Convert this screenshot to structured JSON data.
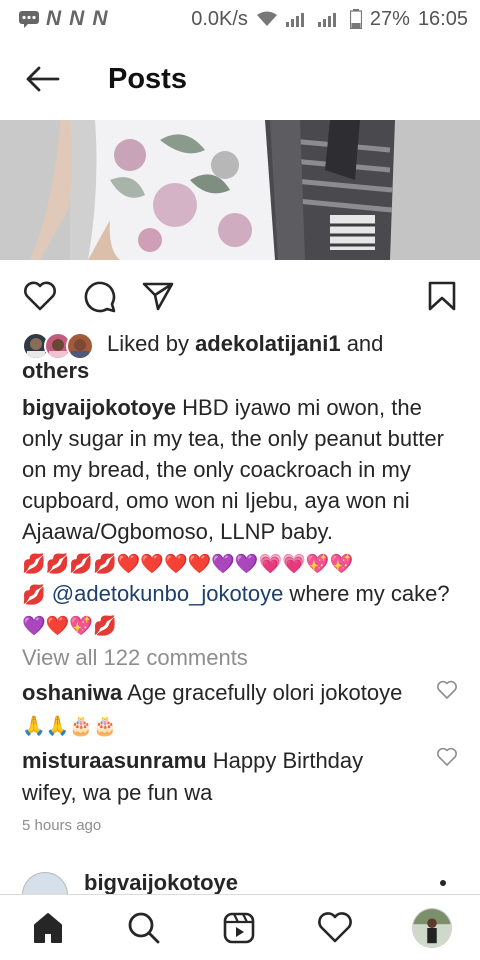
{
  "status_bar": {
    "network_labels": [
      "N",
      "N",
      "N"
    ],
    "speed": "0.0K/s",
    "battery": "27%",
    "time": "16:05"
  },
  "header": {
    "title": "Posts"
  },
  "likes": {
    "prefix": "Liked by ",
    "user": "adekolatijani1",
    "middle": " and",
    "others": "others"
  },
  "caption": {
    "username": "bigvaijokotoye",
    "text": " HBD iyawo mi owon, the only sugar in my tea, the only peanut butter on my bread, the only coackroach in my cupboard, omo won ni Ijebu, aya won ni Ajaawa/Ogbomoso, LLNP baby.",
    "emoji_line_1": "💋💋💋💋❤️❤️❤️❤️💜💜💗💗💖💖",
    "emoji_line_2_prefix": "💋",
    "mention": "@adetokunbo_jokotoye",
    "after_mention": " where my cake?",
    "emoji_line_3": "💜❤️💖💋"
  },
  "view_all": "View all 122 comments",
  "comments": [
    {
      "username": "oshaniwa",
      "text": " Age gracefully olori jokotoye ",
      "emojis": "🙏🙏🎂🎂"
    },
    {
      "username": "misturaasunramu",
      "text": " Happy Birthday wifey, wa pe fun wa",
      "emojis": ""
    }
  ],
  "time_ago": "5 hours ago",
  "next_post": {
    "username": "bigvaijokotoye"
  },
  "colors": {
    "text": "#262626",
    "muted": "#8e8e8e",
    "mention": "#1c3f6e",
    "divider": "#dbdbdb"
  },
  "icons": {
    "actions": [
      "heart-icon",
      "comment-icon",
      "share-icon",
      "bookmark-icon"
    ],
    "tabs": [
      "home-icon",
      "search-icon",
      "reels-icon",
      "activity-heart-icon",
      "profile-avatar"
    ]
  }
}
